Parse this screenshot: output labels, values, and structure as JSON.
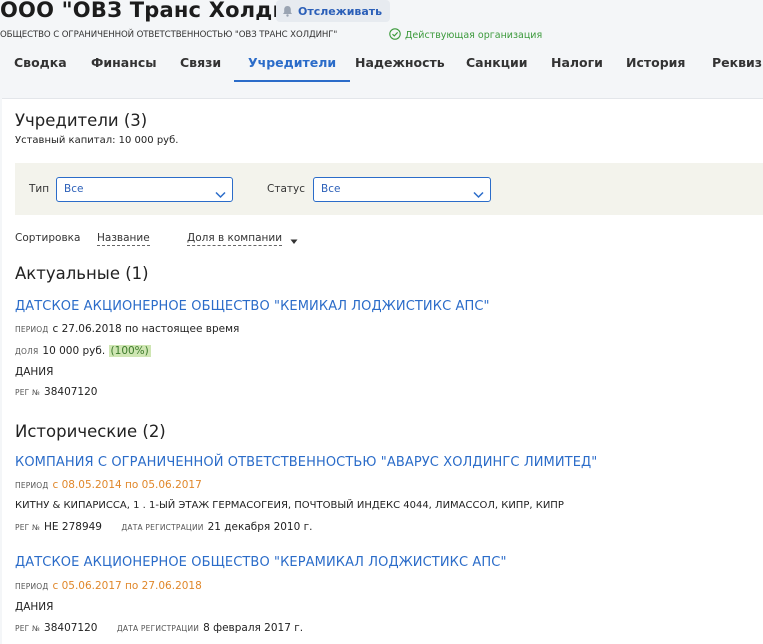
{
  "company": {
    "title": "ООО \"ОВЗ Транс Холдинг\"",
    "full_name": "ОБЩЕСТВО С ОГРАНИЧЕННОЙ ОТВЕТСТВЕННОСТЬЮ \"ОВЗ ТРАНС ХОЛДИНГ\"",
    "status": "Действующая организация",
    "follow_label": "Отслеживать"
  },
  "tabs": [
    {
      "label": "Сводка"
    },
    {
      "label": "Финансы"
    },
    {
      "label": "Связи"
    },
    {
      "label": "Учредители",
      "active": true
    },
    {
      "label": "Надежность"
    },
    {
      "label": "Санкции"
    },
    {
      "label": "Налоги"
    },
    {
      "label": "История"
    },
    {
      "label": "Реквизиты"
    }
  ],
  "founders": {
    "title": "Учредители (3)",
    "capital": "Уставный капитал: 10 000 руб.",
    "filters": {
      "type_label": "Тип",
      "type_value": "Все",
      "status_label": "Статус",
      "status_value": "Все"
    },
    "sort": {
      "label": "Сортировка",
      "by_name": "Название",
      "by_share": "Доля в компании"
    },
    "current": {
      "title": "Актуальные (1)",
      "items": [
        {
          "name": "ДАТСКОЕ АКЦИОНЕРНОЕ ОБЩЕСТВО \"КЕМИКАЛ ЛОДЖИСТИКС АПС\"",
          "period_label": "ПЕРИОД",
          "period": "с 27.06.2018 по настоящее время",
          "share_label": "ДОЛЯ",
          "share": "10 000 руб.",
          "share_pct": "(100%)",
          "country": "ДАНИЯ",
          "reg_label": "РЕГ №",
          "reg": "38407120"
        }
      ]
    },
    "historical": {
      "title": "Исторические (2)",
      "items": [
        {
          "name": "КОМПАНИЯ С ОГРАНИЧЕННОЙ ОТВЕТСТВЕННОСТЬЮ \"АВАРУС ХОЛДИНГС ЛИМИТЕД\"",
          "period_label": "ПЕРИОД",
          "period": "с 08.05.2014 по 05.06.2017",
          "address": "КИТНУ & КИПАРИССА, 1 . 1-ЫЙ ЭТАЖ ГЕРМАСОГЕИЯ, ПОЧТОВЫЙ ИНДЕКС 4044, ЛИМАССОЛ, КИПР, КИПР",
          "reg_label": "РЕГ №",
          "reg": "НЕ 278949",
          "regdate_label": "ДАТА РЕГИСТРАЦИИ",
          "regdate": "21 декабря 2010 г."
        },
        {
          "name": "ДАТСКОЕ АКЦИОНЕРНОЕ ОБЩЕСТВО \"КЕРАМИКАЛ ЛОДЖИСТИКС АПС\"",
          "period_label": "ПЕРИОД",
          "period": "с 05.06.2017 по 27.06.2018",
          "country": "ДАНИЯ",
          "reg_label": "РЕГ №",
          "reg": "38407120",
          "regdate_label": "ДАТА РЕГИСТРАЦИИ",
          "regdate": "8 февраля 2017 г."
        }
      ]
    }
  },
  "icons": {
    "bell": "bell-icon",
    "status": "check-circle-icon",
    "chevron": "chevron-down-icon",
    "caret": "caret-down-icon"
  },
  "colors": {
    "accent": "#2b6cc9",
    "active_status": "#3c9a3c",
    "historical_period": "#e0872a",
    "share_highlight": "#cfe6b3"
  }
}
